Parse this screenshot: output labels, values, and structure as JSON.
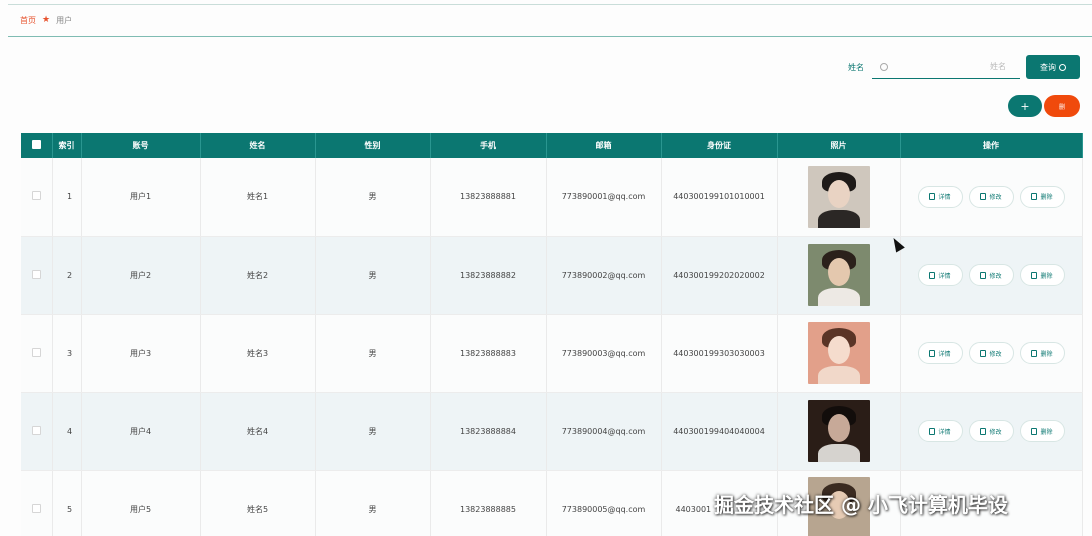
{
  "breadcrumb": {
    "home": "首页",
    "separator_icon": "home-icon",
    "current": "用户"
  },
  "search": {
    "label": "姓名",
    "placeholder": "姓名",
    "value": "",
    "button_label": "查询"
  },
  "actions": {
    "add_label": "+",
    "delete_label": "删"
  },
  "table": {
    "headers": [
      "",
      "索引",
      "账号",
      "姓名",
      "性别",
      "手机",
      "邮箱",
      "身份证",
      "照片",
      "操作"
    ],
    "op_labels": {
      "detail": "详情",
      "edit": "修改",
      "delete": "删除"
    },
    "rows": [
      {
        "index": "1",
        "account": "用户1",
        "name": "姓名1",
        "gender": "男",
        "phone": "13823888881",
        "email": "773890001@qq.com",
        "idcard": "440300199101010001"
      },
      {
        "index": "2",
        "account": "用户2",
        "name": "姓名2",
        "gender": "男",
        "phone": "13823888882",
        "email": "773890002@qq.com",
        "idcard": "440300199202020002"
      },
      {
        "index": "3",
        "account": "用户3",
        "name": "姓名3",
        "gender": "男",
        "phone": "13823888883",
        "email": "773890003@qq.com",
        "idcard": "440300199303030003"
      },
      {
        "index": "4",
        "account": "用户4",
        "name": "姓名4",
        "gender": "男",
        "phone": "13823888884",
        "email": "773890004@qq.com",
        "idcard": "440300199404040004"
      },
      {
        "index": "5",
        "account": "用户5",
        "name": "姓名5",
        "gender": "男",
        "phone": "13823888885",
        "email": "773890005@qq.com",
        "idcard": "4403001"
      }
    ]
  },
  "watermark": "掘金技术社区 @ 小飞计算机毕设",
  "colors": {
    "primary": "#0b7771",
    "danger": "#f04a0c",
    "breadcrumb_accent": "#e7522d"
  }
}
